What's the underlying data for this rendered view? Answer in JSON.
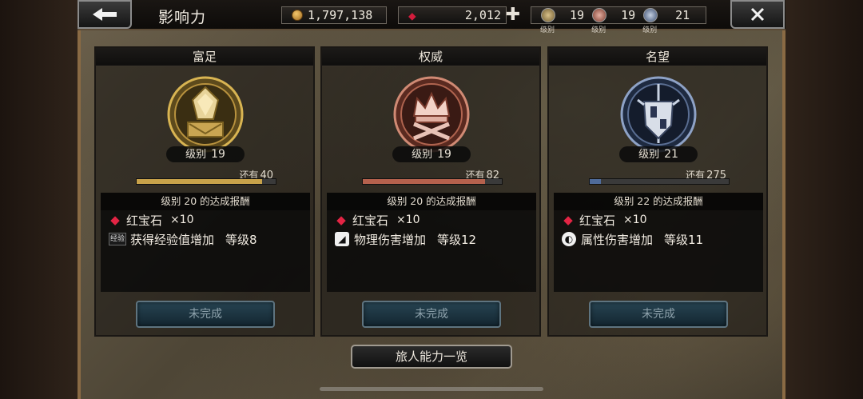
{
  "header": {
    "title": "影响力",
    "gold": "1,797,138",
    "rubies": "2,012",
    "wealth_badge_level": "19",
    "power_badge_level": "19",
    "fame_badge_level": "21",
    "badge_caption": "级别"
  },
  "panels": [
    {
      "name": "富足",
      "level_label": "级别",
      "level": "19",
      "remaining_label": "还有",
      "remaining": "40",
      "progress": 0.9,
      "accent": "#c8a24a",
      "reward_title": "级别 20 的达成报酬",
      "reward1_name": "红宝石",
      "reward1_qty": "×10",
      "reward2_icon_text": "经验",
      "reward2_name": "获得经验值增加",
      "reward2_level": "等级8",
      "button": "未完成"
    },
    {
      "name": "权威",
      "level_label": "级别",
      "level": "19",
      "remaining_label": "还有",
      "remaining": "82",
      "progress": 0.88,
      "accent": "#b5614d",
      "reward_title": "级别 20 的达成报酬",
      "reward1_name": "红宝石",
      "reward1_qty": "×10",
      "reward2_icon_text": "",
      "reward2_name": "物理伤害增加",
      "reward2_level": "等级12",
      "button": "未完成"
    },
    {
      "name": "名望",
      "level_label": "级别",
      "level": "21",
      "remaining_label": "还有",
      "remaining": "275",
      "progress": 0.08,
      "accent": "#4f6b9a",
      "reward_title": "级别 22 的达成报酬",
      "reward1_name": "红宝石",
      "reward1_qty": "×10",
      "reward2_icon_text": "",
      "reward2_name": "属性伤害增加",
      "reward2_level": "等级11",
      "button": "未完成"
    }
  ],
  "footer": {
    "traveler_abilities_button": "旅人能力一览"
  },
  "colors": {
    "ruby": "#d21c3c",
    "gold": "#f3c66b",
    "button_teal": "#274452"
  },
  "icons": [
    "back-arrow-icon",
    "close-icon",
    "gold-coin-icon",
    "ruby-icon",
    "plus-icon",
    "wealth-emblem-icon",
    "power-emblem-icon",
    "fame-emblem-icon",
    "experience-icon",
    "physical-attack-icon",
    "elemental-attack-icon"
  ]
}
